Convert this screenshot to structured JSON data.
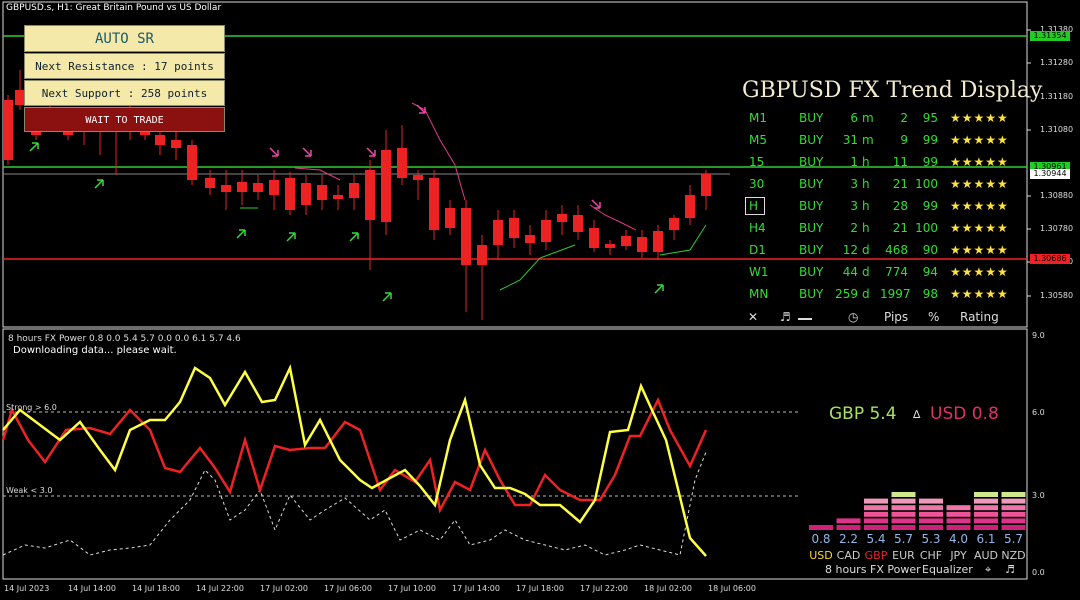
{
  "window": {
    "title": "GBPUSD.s, H1:  Great Britain Pound vs US Dollar"
  },
  "sr_panel": {
    "title": "AUTO SR",
    "resistance": "Next Resistance : 17 points",
    "support": "Next Support : 258 points",
    "status": "WAIT TO TRADE"
  },
  "trend_display": {
    "title": "GBPUSD FX Trend Display",
    "rows": [
      {
        "tf": "M1",
        "signal": "BUY",
        "age_num": "6",
        "age_unit": "m",
        "pips": "2",
        "pct": "95",
        "stars": "★★★★★"
      },
      {
        "tf": "M5",
        "signal": "BUY",
        "age_num": "31",
        "age_unit": "m",
        "pips": "9",
        "pct": "99",
        "stars": "★★★★★"
      },
      {
        "tf": "15",
        "signal": "BUY",
        "age_num": "1",
        "age_unit": "h",
        "pips": "11",
        "pct": "99",
        "stars": "★★★★★"
      },
      {
        "tf": "30",
        "signal": "BUY",
        "age_num": "3",
        "age_unit": "h",
        "pips": "21",
        "pct": "100",
        "stars": "★★★★★"
      },
      {
        "tf": "H",
        "signal": "BUY",
        "age_num": "3",
        "age_unit": "h",
        "pips": "28",
        "pct": "99",
        "stars": "★★★★★"
      },
      {
        "tf": "H4",
        "signal": "BUY",
        "age_num": "2",
        "age_unit": "h",
        "pips": "21",
        "pct": "100",
        "stars": "★★★★★"
      },
      {
        "tf": "D1",
        "signal": "BUY",
        "age_num": "12",
        "age_unit": "d",
        "pips": "468",
        "pct": "90",
        "stars": "★★★★★"
      },
      {
        "tf": "W1",
        "signal": "BUY",
        "age_num": "44",
        "age_unit": "d",
        "pips": "774",
        "pct": "94",
        "stars": "★★★★★"
      },
      {
        "tf": "MN",
        "signal": "BUY",
        "age_num": "259",
        "age_unit": "d",
        "pips": "1997",
        "pct": "98",
        "stars": "★★★★★"
      }
    ],
    "footer": {
      "close": "✕",
      "music": "♬",
      "clock": "◷",
      "pips": "Pips",
      "pct": "%",
      "rating": "Rating"
    }
  },
  "price_axis": {
    "labels": [
      "1.31380",
      "1.31280",
      "1.31180",
      "1.31080",
      "1.30880",
      "1.30780",
      "1.30680",
      "1.30580"
    ],
    "tags": [
      {
        "text": "1.31354",
        "color": "#22cc22"
      },
      {
        "text": "1.30961",
        "color": "#22cc22"
      },
      {
        "text": "1.30944",
        "color": "#ffffff"
      },
      {
        "text": "1.30686",
        "color": "#ee2222"
      }
    ]
  },
  "time_axis": [
    "14 Jul 2023",
    "14 Jul 14:00",
    "14 Jul 18:00",
    "14 Jul 22:00",
    "17 Jul 02:00",
    "17 Jul 06:00",
    "17 Jul 10:00",
    "17 Jul 14:00",
    "17 Jul 18:00",
    "17 Jul 22:00",
    "18 Jul 02:00",
    "18 Jul 06:00"
  ],
  "fx_power": {
    "header": "8 hours FX Power 0.8 0.0 5.4 5.7 0.0 0.0 6.1 5.7 4.6",
    "status": "Downloading data... please wait.",
    "strong_label": "Strong > 6.0",
    "weak_label": "Weak < 3.0",
    "scale_labels": [
      "9.0",
      "6.0",
      "3.0",
      "0.0"
    ],
    "gbp_text": "GBP 5.4",
    "delta": "∆",
    "usd_text": "USD 0.8",
    "colors": {
      "gbp": "#a8e060",
      "usd": "#e0306a",
      "line_red": "#ee2222",
      "line_yellow": "#ffff44"
    },
    "equalizer": {
      "values": [
        "0.8",
        "2.2",
        "5.4",
        "5.7",
        "5.3",
        "4.0",
        "6.1",
        "5.7"
      ],
      "currencies": [
        "USD",
        "CAD",
        "GBP",
        "EUR",
        "CHF",
        "JPY",
        "AUD",
        "NZD"
      ],
      "levels": [
        0.8,
        2.2,
        5.4,
        5.7,
        5.3,
        4.0,
        6.1,
        5.7
      ],
      "footer_period": "8 hours",
      "footer_name": "FX Power",
      "footer_mode": "Equalizer"
    }
  }
}
